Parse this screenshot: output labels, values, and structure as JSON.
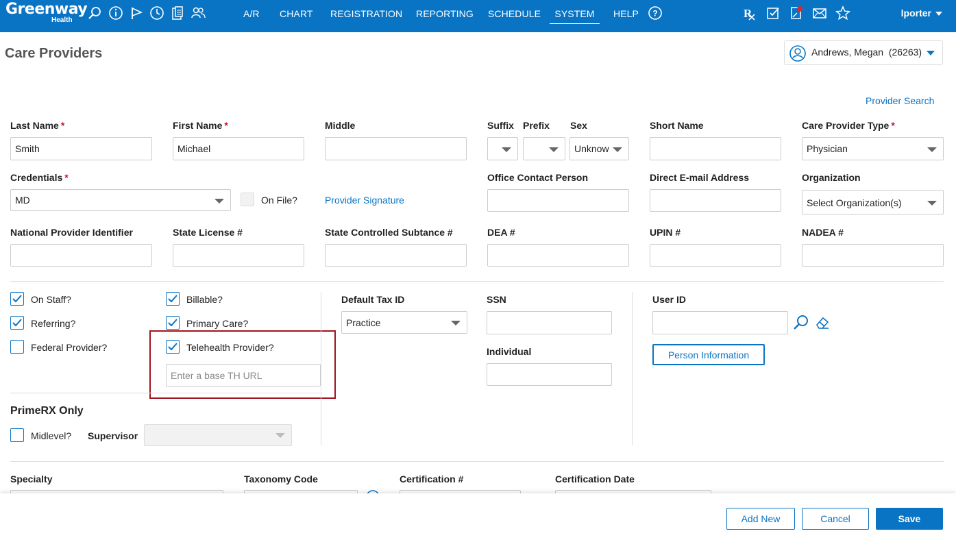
{
  "brand": {
    "name": "Greenway",
    "sub": "Health"
  },
  "nav": {
    "icons": [
      "search-icon",
      "info-icon",
      "flag-icon",
      "clock-icon",
      "clipboard-icon",
      "people-icon"
    ],
    "items": [
      "A/R",
      "CHART",
      "REGISTRATION",
      "REPORTING",
      "SCHEDULE",
      "SYSTEM",
      "HELP"
    ],
    "active": "SYSTEM",
    "right_icons": [
      "rx-icon",
      "task-check-icon",
      "document-alert-icon",
      "mail-icon",
      "star-icon"
    ],
    "user": "lporter"
  },
  "page": {
    "title": "Care Providers"
  },
  "patient": {
    "name": "Andrews, Megan",
    "id": "(26263)"
  },
  "provider_search": "Provider Search",
  "fields": {
    "last_name": {
      "label": "Last Name",
      "value": "Smith"
    },
    "first_name": {
      "label": "First Name",
      "value": "Michael"
    },
    "middle": {
      "label": "Middle",
      "value": ""
    },
    "suffix": {
      "label": "Suffix",
      "value": ""
    },
    "prefix": {
      "label": "Prefix",
      "value": ""
    },
    "sex": {
      "label": "Sex",
      "value": "Unknow"
    },
    "short_name": {
      "label": "Short Name",
      "value": ""
    },
    "care_provider_type": {
      "label": "Care Provider Type",
      "value": "Physician"
    },
    "credentials": {
      "label": "Credentials",
      "value": "MD"
    },
    "on_file": {
      "label": "On File?"
    },
    "provider_signature": "Provider Signature",
    "office_contact": {
      "label": "Office Contact Person",
      "value": ""
    },
    "direct_email": {
      "label": "Direct E-mail Address",
      "value": ""
    },
    "organization": {
      "label": "Organization",
      "value": "Select Organization(s)"
    },
    "npi": {
      "label": "National Provider Identifier",
      "value": ""
    },
    "state_license": {
      "label": "State License #",
      "value": ""
    },
    "state_controlled": {
      "label": "State Controlled Subtance #",
      "value": ""
    },
    "dea": {
      "label": "DEA #",
      "value": ""
    },
    "upin": {
      "label": "UPIN #",
      "value": ""
    },
    "nadea": {
      "label": "NADEA #",
      "value": ""
    }
  },
  "checks": {
    "on_staff": {
      "label": "On Staff?",
      "checked": true
    },
    "referring": {
      "label": "Referring?",
      "checked": true
    },
    "federal": {
      "label": "Federal Provider?",
      "checked": false
    },
    "billable": {
      "label": "Billable?",
      "checked": true
    },
    "primary_care": {
      "label": "Primary Care?",
      "checked": true
    },
    "telehealth": {
      "label": "Telehealth Provider?",
      "checked": true
    },
    "th_url_placeholder": "Enter a base TH URL"
  },
  "tax": {
    "default_tax_id": {
      "label": "Default Tax ID",
      "value": "Practice"
    },
    "ssn": {
      "label": "SSN",
      "value": ""
    },
    "individual": {
      "label": "Individual",
      "value": ""
    }
  },
  "user": {
    "user_id": {
      "label": "User ID",
      "value": ""
    },
    "person_info": "Person Information"
  },
  "primerx": {
    "title": "PrimeRX Only",
    "midlevel": {
      "label": "Midlevel?",
      "checked": false
    },
    "supervisor": {
      "label": "Supervisor",
      "value": ""
    }
  },
  "lower": {
    "specialty": "Specialty",
    "taxonomy": "Taxonomy Code",
    "certification": "Certification #",
    "cert_date": "Certification Date"
  },
  "buttons": {
    "add_new": "Add New",
    "cancel": "Cancel",
    "save": "Save"
  },
  "colors": {
    "brand": "#0a74c4",
    "required": "#c8102e",
    "highlight": "#a0141e"
  }
}
